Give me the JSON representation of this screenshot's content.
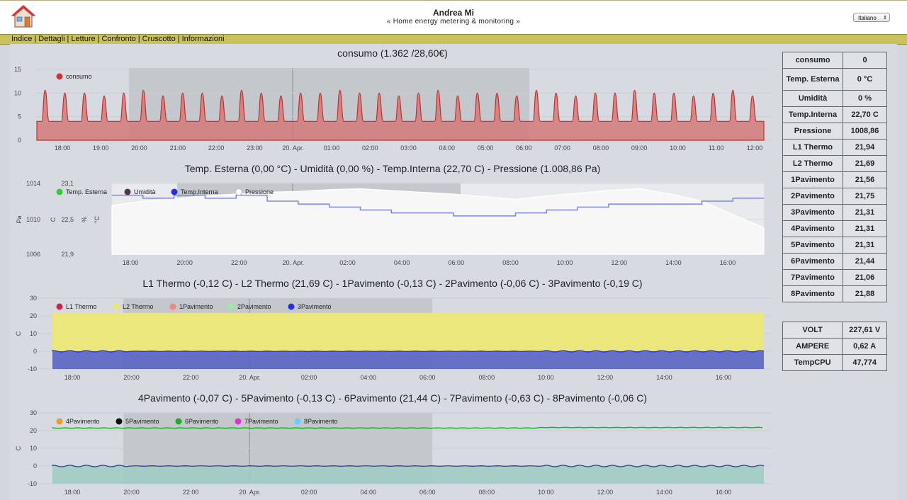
{
  "header": {
    "title": "Andrea Mi",
    "subtitle": "« Home energy metering & monitoring »",
    "language": "Italiano"
  },
  "menu": [
    {
      "label": "Indice"
    },
    {
      "label": "Dettagli"
    },
    {
      "label": "Letture"
    },
    {
      "label": "Confronto"
    },
    {
      "label": "Cruscotto"
    },
    {
      "label": "Informazioni"
    }
  ],
  "sidebar": {
    "sensors": [
      {
        "label": "consumo",
        "value": "0"
      },
      {
        "label": "Temp. Esterna",
        "value": "0 °C"
      },
      {
        "label": "Umidità",
        "value": "0 %"
      },
      {
        "label": "Temp.Interna",
        "value": "22,70 C"
      },
      {
        "label": "Pressione",
        "value": "1008,86"
      },
      {
        "label": "L1 Thermo",
        "value": "21,94"
      },
      {
        "label": "L2 Thermo",
        "value": "21,69"
      },
      {
        "label": "1Pavimento",
        "value": "21,56"
      },
      {
        "label": "2Pavimento",
        "value": "21,75"
      },
      {
        "label": "3Pavimento",
        "value": "21,31"
      },
      {
        "label": "4Pavimento",
        "value": "21,31"
      },
      {
        "label": "5Pavimento",
        "value": "21,31"
      },
      {
        "label": "6Pavimento",
        "value": "21,44"
      },
      {
        "label": "7Pavimento",
        "value": "21,06"
      },
      {
        "label": "8Pavimento",
        "value": "21,88"
      }
    ],
    "electrical": [
      {
        "label": "VOLT",
        "value": "227,61 V"
      },
      {
        "label": "AMPERE",
        "value": "0,62 A"
      },
      {
        "label": "TempCPU",
        "value": "47,774"
      }
    ]
  },
  "chart_data": [
    {
      "type": "area",
      "title": "consumo (1.362 /28,60€)",
      "x_ticks": [
        "18:00",
        "19:00",
        "20:00",
        "21:00",
        "22:00",
        "23:00",
        "20. Apr.",
        "01:00",
        "02:00",
        "03:00",
        "04:00",
        "05:00",
        "06:00",
        "07:00",
        "08:00",
        "09:00",
        "10:00",
        "11:00",
        "12:00"
      ],
      "y_ticks": [
        "0",
        "5",
        "10",
        "15"
      ],
      "ylim": [
        0,
        15
      ],
      "series": [
        {
          "name": "consumo",
          "color": "#cc3333",
          "baseline": 4,
          "peak": 10,
          "cycles": 37
        }
      ],
      "grid": true,
      "legend": "top-left"
    },
    {
      "type": "line",
      "title": "Temp. Esterna (0,00 °C) - Umidità (0,00 %) - Temp.Interna (22,70 C) - Pressione (1.008,86 Pa)",
      "x_ticks": [
        "18:00",
        "20:00",
        "22:00",
        "20. Apr.",
        "02:00",
        "04:00",
        "06:00",
        "08:00",
        "10:00",
        "12:00",
        "14:00",
        "16:00"
      ],
      "y_ticks_pressure": [
        "1006",
        "1010",
        "1014"
      ],
      "y_ticks_temp": [
        "21,9",
        "22,5",
        "23,1"
      ],
      "axis_units": [
        "Pa",
        "C",
        "%",
        "°C"
      ],
      "series": [
        {
          "name": "Temp. Esterna",
          "color": "#33cc33"
        },
        {
          "name": "Umidità",
          "color": "#553355"
        },
        {
          "name": "Temp.Interna",
          "color": "#2233cc",
          "values": [
            22.9,
            22.85,
            22.9,
            22.85,
            22.9,
            22.8,
            22.75,
            22.7,
            22.65,
            22.6,
            22.6,
            22.55,
            22.55,
            22.6,
            22.65,
            22.7,
            22.75,
            22.75,
            22.75,
            22.8,
            22.85,
            22.85
          ]
        },
        {
          "name": "Pressione",
          "color": "#ffffff",
          "values": [
            1011.5,
            1012,
            1012.3,
            1012.6,
            1012.8,
            1013,
            1013.1,
            1013.3,
            1013.4,
            1013.2,
            1013,
            1012.8,
            1012.5,
            1012.2,
            1012.6,
            1012.9,
            1013.2,
            1013.4,
            1012.8,
            1012,
            1010.5,
            1009
          ]
        }
      ],
      "grid": true,
      "legend": "top-left"
    },
    {
      "type": "area",
      "title": "L1 Thermo (-0,12 C) - L2 Thermo (21,69 C) - 1Pavimento (-0,13 C) - 2Pavimento (-0,06 C) - 3Pavimento (-0,19 C)",
      "x_ticks": [
        "18:00",
        "20:00",
        "22:00",
        "20. Apr.",
        "02:00",
        "04:00",
        "06:00",
        "08:00",
        "10:00",
        "12:00",
        "14:00",
        "16:00"
      ],
      "y_ticks": [
        "-10",
        "0",
        "10",
        "20",
        "30"
      ],
      "ylim": [
        -10,
        30
      ],
      "axis_unit": "C",
      "series": [
        {
          "name": "L1 Thermo",
          "color": "#cc2244",
          "value": -0.12
        },
        {
          "name": "L2 Thermo",
          "color": "#f0e860",
          "value": 21.69
        },
        {
          "name": "1Pavimento",
          "color": "#ee8888",
          "value": -0.13
        },
        {
          "name": "2Pavimento",
          "color": "#99ee99",
          "value": -0.06
        },
        {
          "name": "3Pavimento",
          "color": "#2233dd",
          "value": -0.19
        }
      ],
      "grid": true,
      "legend": "top-left"
    },
    {
      "type": "area",
      "title": "4Pavimento (-0,07 C) - 5Pavimento (-0,13 C) - 6Pavimento (21,44 C) - 7Pavimento (-0,63 C) - 8Pavimento (-0,06 C)",
      "x_ticks": [
        "18:00",
        "20:00",
        "22:00",
        "20. Apr.",
        "02:00",
        "04:00",
        "06:00",
        "08:00",
        "10:00",
        "12:00",
        "14:00",
        "16:00"
      ],
      "y_ticks": [
        "-10",
        "0",
        "10",
        "20",
        "30"
      ],
      "ylim": [
        -10,
        30
      ],
      "axis_unit": "C",
      "series": [
        {
          "name": "4Pavimento",
          "color": "#ee9933",
          "value": -0.07
        },
        {
          "name": "5Pavimento",
          "color": "#111111",
          "value": -0.13
        },
        {
          "name": "6Pavimento",
          "color": "#22aa33",
          "value": 21.44
        },
        {
          "name": "7Pavimento",
          "color": "#dd33cc",
          "value": -0.63
        },
        {
          "name": "8Pavimento",
          "color": "#66ccff",
          "value": -0.06
        }
      ],
      "grid": true,
      "legend": "top-left"
    }
  ]
}
